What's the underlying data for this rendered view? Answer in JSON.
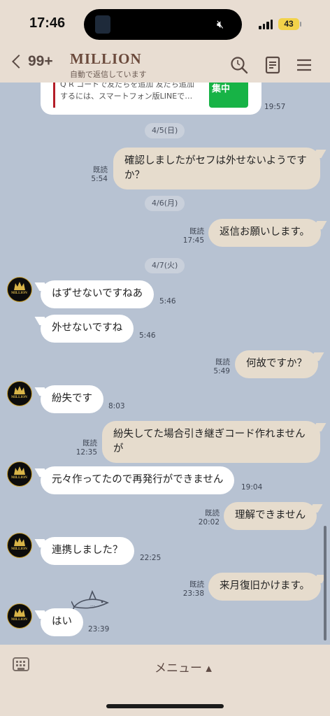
{
  "status_bar": {
    "time": "17:46",
    "battery": "43"
  },
  "header": {
    "back_count": "99+",
    "title": "MILLION",
    "subtitle": "自動で返信しています"
  },
  "preview_card": {
    "text": "Q R コードで友だちを追加 友だち追加\nするには、スマートフォン版LINEで…",
    "thumb": "集中",
    "time": "19:57"
  },
  "avatar_label": "MILLION",
  "dates": [
    "4/5(日)",
    "4/6(月)",
    "4/7(火)"
  ],
  "messages": [
    {
      "text": "確認しましたがセフは外せないようですか？",
      "read": "既読",
      "time": "5:54"
    },
    {
      "text": "返信お願いします。",
      "read": "既読",
      "time": "17:45"
    },
    {
      "text": "はずせないですねあ",
      "time": "5:46"
    },
    {
      "text": "外せないですね",
      "time": "5:46"
    },
    {
      "text": "何故ですか？",
      "read": "既読",
      "time": "5:49"
    },
    {
      "text": "紛失です",
      "time": "8:03"
    },
    {
      "text": "紛失してた場合引き継ぎコード作れませんが",
      "read": "既読",
      "time": "12:35"
    },
    {
      "text": "元々作ってたので再発行ができません",
      "time": "19:04"
    },
    {
      "text": "理解できません",
      "read": "既読",
      "time": "20:02"
    },
    {
      "text": "連携しました？",
      "time": "22:25"
    },
    {
      "text": "来月復旧かけます。",
      "read": "既読",
      "time": "23:38"
    },
    {
      "text": "はい",
      "time": "23:39"
    }
  ],
  "bottom_bar": {
    "menu_label": "メニュー ▴"
  },
  "colors": {
    "chat_bg": "#b7c2d2",
    "bar_bg": "#e8ddd2",
    "outgoing_bubble": "#e6dccd",
    "incoming_bubble": "#ffffff"
  }
}
